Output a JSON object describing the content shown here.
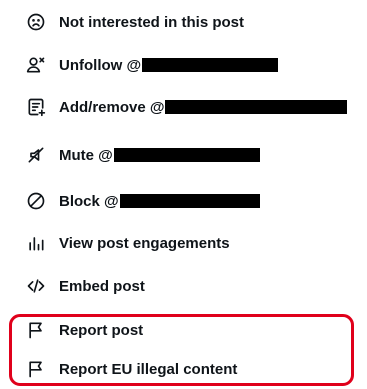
{
  "menu": {
    "items": [
      {
        "name": "not-interested",
        "icon": "sad-face-icon",
        "label": "Not interested in this post",
        "redacted": false
      },
      {
        "name": "unfollow",
        "icon": "person-x-icon",
        "label": "Unfollow @",
        "redacted": true
      },
      {
        "name": "add-remove-list",
        "icon": "list-add-icon",
        "label": "Add/remove @",
        "redacted": true
      },
      {
        "name": "mute",
        "icon": "mute-icon",
        "label": "Mute @",
        "redacted": true
      },
      {
        "name": "block",
        "icon": "block-icon",
        "label": "Block @",
        "redacted": true
      },
      {
        "name": "view-engagements",
        "icon": "bar-chart-icon",
        "label": "View post engagements",
        "redacted": false
      },
      {
        "name": "embed-post",
        "icon": "code-icon",
        "label": "Embed post",
        "redacted": false
      },
      {
        "name": "report-post",
        "icon": "flag-icon",
        "label": "Report post",
        "redacted": false
      },
      {
        "name": "report-eu-illegal",
        "icon": "flag-icon",
        "label": "Report EU illegal content",
        "redacted": false
      }
    ]
  },
  "annotation": {
    "highlight_color": "#e0001b",
    "redaction_color": "#000000"
  }
}
